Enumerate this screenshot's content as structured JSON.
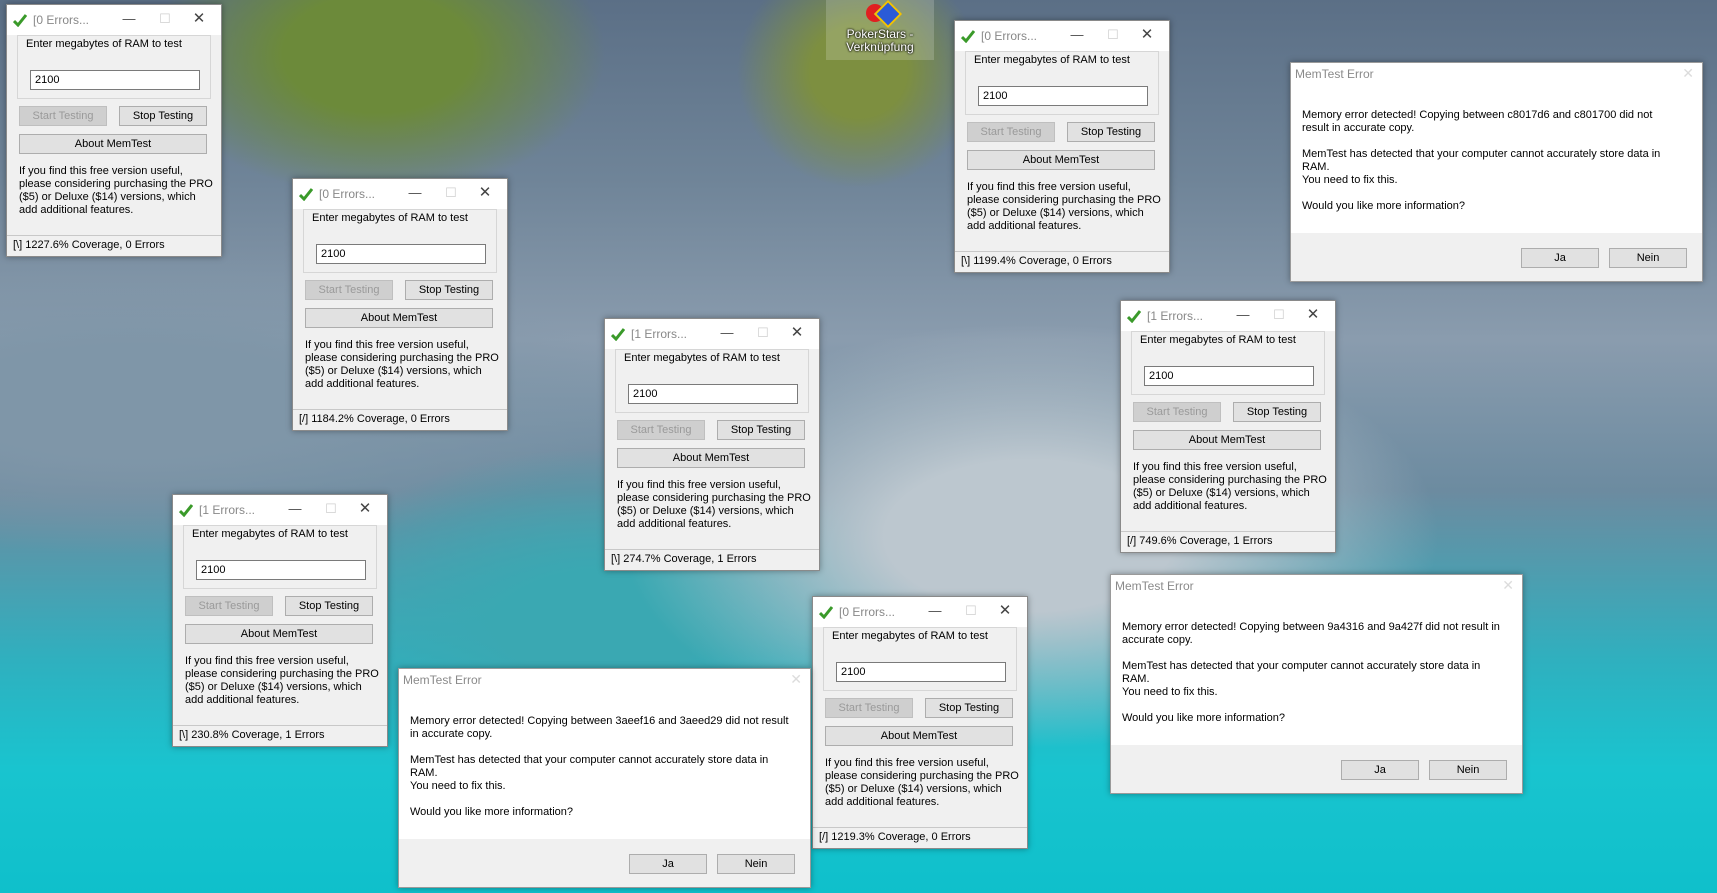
{
  "desktop": {
    "shortcut_label": "PokerStars - Verknüpfung"
  },
  "windows": [
    {
      "title": "[0 Errors...",
      "prompt": "Enter megabytes of RAM to test",
      "ram_value": "2100",
      "start": "Start Testing",
      "stop": "Stop Testing",
      "about": "About MemTest",
      "info": "If you find this free version useful, please considering purchasing the PRO ($5) or Deluxe ($14) versions, which add additional features.",
      "status": "[\\]  1227.6% Coverage, 0 Errors"
    },
    {
      "title": "[0 Errors...",
      "prompt": "Enter megabytes of RAM to test",
      "ram_value": "2100",
      "start": "Start Testing",
      "stop": "Stop Testing",
      "about": "About MemTest",
      "info": "If you find this free version useful, please considering purchasing the PRO ($5) or Deluxe ($14) versions, which add additional features.",
      "status": "[/]  1184.2% Coverage, 0 Errors"
    },
    {
      "title": "[1 Errors...",
      "prompt": "Enter megabytes of RAM to test",
      "ram_value": "2100",
      "start": "Start Testing",
      "stop": "Stop Testing",
      "about": "About MemTest",
      "info": "If you find this free version useful, please considering purchasing the PRO ($5) or Deluxe ($14) versions, which add additional features.",
      "status": "[\\]  230.8% Coverage, 1 Errors"
    },
    {
      "title": "[1 Errors...",
      "prompt": "Enter megabytes of RAM to test",
      "ram_value": "2100",
      "start": "Start Testing",
      "stop": "Stop Testing",
      "about": "About MemTest",
      "info": "If you find this free version useful, please considering purchasing the PRO ($5) or Deluxe ($14) versions, which add additional features.",
      "status": "[\\]  274.7% Coverage, 1 Errors"
    },
    {
      "title": "[0 Errors...",
      "prompt": "Enter megabytes of RAM to test",
      "ram_value": "2100",
      "start": "Start Testing",
      "stop": "Stop Testing",
      "about": "About MemTest",
      "info": "If you find this free version useful, please considering purchasing the PRO ($5) or Deluxe ($14) versions, which add additional features.",
      "status": "[\\]  1199.4% Coverage, 0 Errors"
    },
    {
      "title": "[1 Errors...",
      "prompt": "Enter megabytes of RAM to test",
      "ram_value": "2100",
      "start": "Start Testing",
      "stop": "Stop Testing",
      "about": "About MemTest",
      "info": "If you find this free version useful, please considering purchasing the PRO ($5) or Deluxe ($14) versions, which add additional features.",
      "status": "[/]  749.6% Coverage, 1 Errors"
    },
    {
      "title": "[0 Errors...",
      "prompt": "Enter megabytes of RAM to test",
      "ram_value": "2100",
      "start": "Start Testing",
      "stop": "Stop Testing",
      "about": "About MemTest",
      "info": "If you find this free version useful, please considering purchasing the PRO ($5) or Deluxe ($14) versions, which add additional features.",
      "status": "[/]  1219.3% Coverage, 0 Errors"
    }
  ],
  "errors": [
    {
      "title": "MemTest Error",
      "line1": "Memory error detected! Copying between c8017d6 and c801700 did not result in accurate copy.",
      "line2": "MemTest has detected that your computer cannot accurately store data in RAM.",
      "line3": "You need to fix this.",
      "line4": "Would you like more information?",
      "yes": "Ja",
      "no": "Nein"
    },
    {
      "title": "MemTest Error",
      "line1": "Memory error detected! Copying between 9a4316 and 9a427f did not result in accurate copy.",
      "line2": "MemTest has detected that your computer cannot accurately store data in RAM.",
      "line3": "You need to fix this.",
      "line4": "Would you like more information?",
      "yes": "Ja",
      "no": "Nein"
    },
    {
      "title": "MemTest Error",
      "line1": "Memory error detected! Copying between 3aeef16 and 3aeed29 did not result in accurate copy.",
      "line2": "MemTest has detected that your computer cannot accurately store data in RAM.",
      "line3": "You need to fix this.",
      "line4": "Would you like more information?",
      "yes": "Ja",
      "no": "Nein"
    }
  ]
}
